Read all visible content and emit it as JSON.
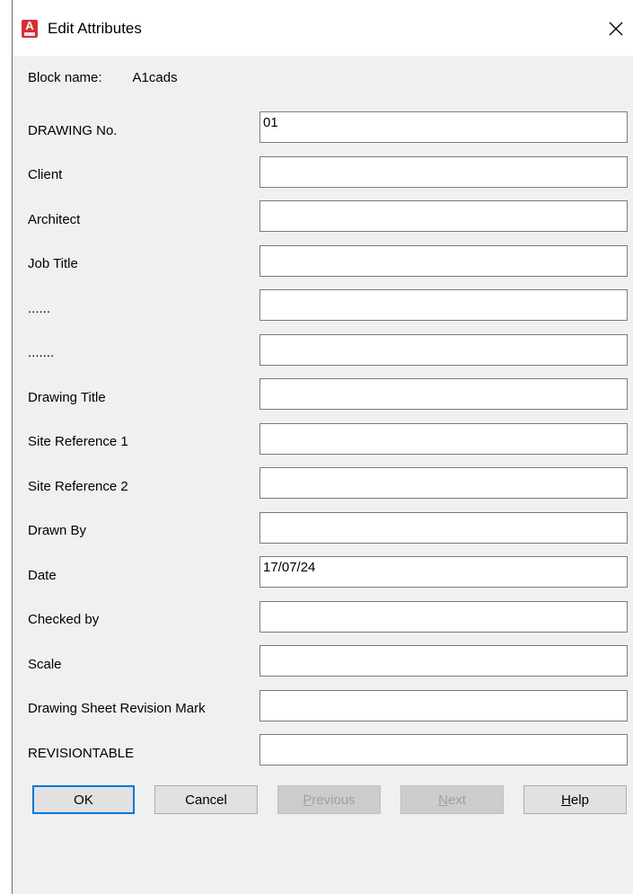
{
  "window": {
    "title": "Edit Attributes",
    "app_icon": "autocad-icon",
    "close_icon": "close-icon"
  },
  "block": {
    "label": "Block name:",
    "value": "A1cads"
  },
  "fields": [
    {
      "label": "DRAWING No.",
      "value": "01",
      "placeholder": ""
    },
    {
      "label": "Client",
      "value": "",
      "placeholder": ""
    },
    {
      "label": "Architect",
      "value": "",
      "placeholder": ""
    },
    {
      "label": "Job Title",
      "value": "",
      "placeholder": ""
    },
    {
      "label": "......",
      "value": "",
      "placeholder": ""
    },
    {
      "label": ".......",
      "value": "",
      "placeholder": ""
    },
    {
      "label": "Drawing Title",
      "value": "",
      "placeholder": ""
    },
    {
      "label": "Site Reference 1",
      "value": "",
      "placeholder": ""
    },
    {
      "label": "Site Reference 2",
      "value": "",
      "placeholder": ""
    },
    {
      "label": "Drawn By",
      "value": "",
      "placeholder": ""
    },
    {
      "label": "Date",
      "value": "17/07/24",
      "placeholder": ""
    },
    {
      "label": "Checked by",
      "value": "",
      "placeholder": ""
    },
    {
      "label": "Scale",
      "value": "",
      "placeholder": ""
    },
    {
      "label": "Drawing Sheet Revision Mark",
      "value": "",
      "placeholder": ""
    },
    {
      "label": "REVISIONTABLE",
      "value": "",
      "placeholder": ""
    }
  ],
  "buttons": {
    "ok": "OK",
    "cancel": "Cancel",
    "previous_first": "P",
    "previous_rest": "revious",
    "next_first": "N",
    "next_rest": "ext",
    "help_first": "H",
    "help_rest": "elp"
  },
  "colors": {
    "dialog_bg": "#f0f0f0",
    "default_button_border": "#0078d7",
    "app_icon": "#d62e36",
    "disabled_text": "#a0a0a0"
  }
}
